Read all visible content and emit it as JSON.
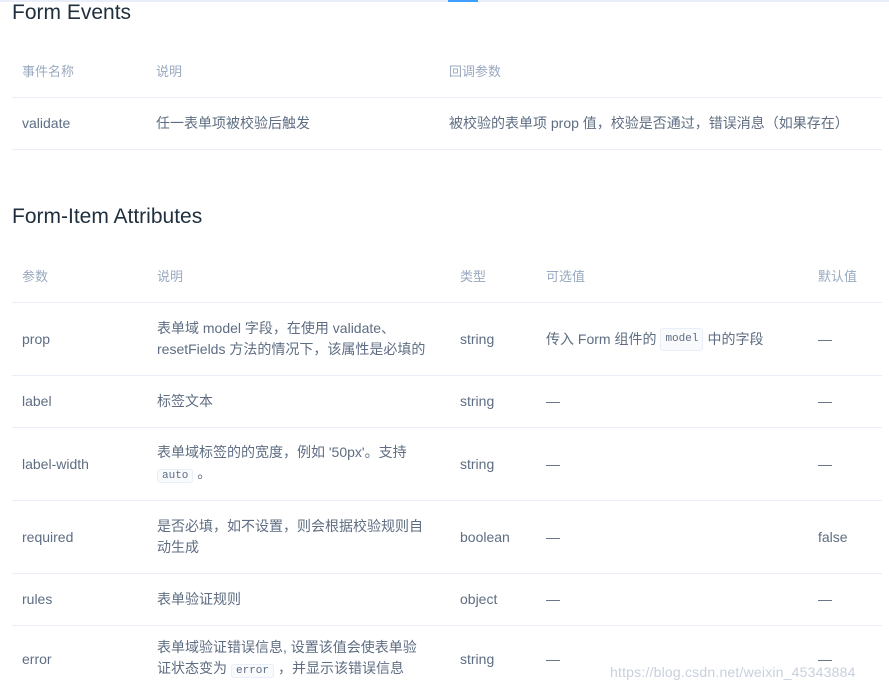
{
  "events": {
    "title": "Form Events",
    "headers": [
      "事件名称",
      "说明",
      "回调参数"
    ],
    "rows": [
      {
        "name": "validate",
        "desc": "任一表单项被校验后触发",
        "params": "被校验的表单项 prop 值，校验是否通过，错误消息（如果存在）"
      }
    ]
  },
  "attrs": {
    "title": "Form-Item Attributes",
    "headers": [
      "参数",
      "说明",
      "类型",
      "可选值",
      "默认值"
    ],
    "rows": [
      {
        "param": "prop",
        "desc_a": "表单域 model 字段，在使用 validate、",
        "desc_b": "resetFields 方法的情况下，该属性是必填的",
        "type": "string",
        "opt_a": "传入 Form 组件的",
        "opt_code": "model",
        "opt_b": "中的字段",
        "def": "—"
      },
      {
        "param": "label",
        "desc": "标签文本",
        "type": "string",
        "opt": "—",
        "def": "—"
      },
      {
        "param": "label-width",
        "desc_a": "表单域标签的的宽度，例如 '50px'。支持",
        "desc_code": "auto",
        "desc_b": "。",
        "type": "string",
        "opt": "—",
        "def": "—"
      },
      {
        "param": "required",
        "desc_a": "是否必填，如不设置，则会根据校验规则自",
        "desc_b": "动生成",
        "type": "boolean",
        "opt": "—",
        "def": "false"
      },
      {
        "param": "rules",
        "desc": "表单验证规则",
        "type": "object",
        "opt": "—",
        "def": "—"
      },
      {
        "param": "error",
        "desc_a": "表单域验证错误信息, 设置该值会使表单验",
        "desc_b": "证状态变为",
        "desc_code": "error",
        "desc_c": "，并显示该错误信息",
        "type": "string",
        "opt": "—",
        "def": "—"
      }
    ]
  },
  "watermark": "https://blog.csdn.net/weixin_45343884"
}
